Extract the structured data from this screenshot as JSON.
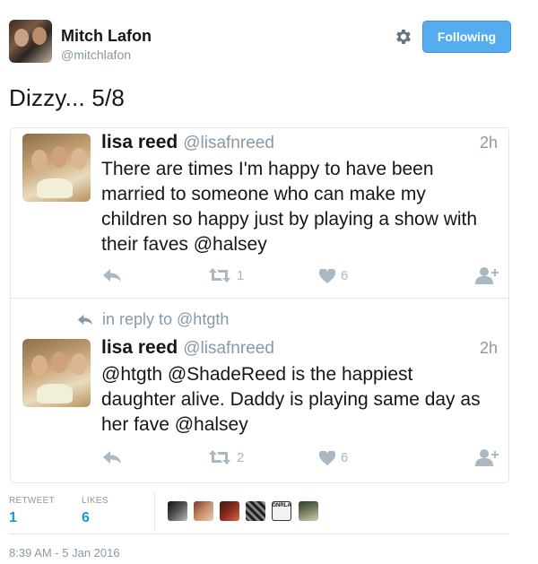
{
  "header": {
    "author_name": "Mitch Lafon",
    "author_handle": "@mitchlafon",
    "follow_label": "Following"
  },
  "tweet": {
    "text": "Dizzy... 5/8"
  },
  "conversation": [
    {
      "name": "lisa reed",
      "handle": "@lisafnreed",
      "time": "2h",
      "text": "There are times I'm happy to have been married to someone who can make my children so happy just by playing a show with their faves @halsey",
      "retweets": "1",
      "likes": "6"
    },
    {
      "reply_context": "in reply to @htgth",
      "name": "lisa reed",
      "handle": "@lisafnreed",
      "time": "2h",
      "text": "@htgth @ShadeReed is the happiest daughter alive. Daddy is playing same day as her fave @halsey",
      "retweets": "2",
      "likes": "6"
    }
  ],
  "stats": {
    "retweet_label": "RETWEET",
    "retweet_count": "1",
    "likes_label": "LIKES",
    "likes_count": "6",
    "liker_badge_text": "GNRLA"
  },
  "timestamp": "8:39 AM - 5 Jan 2016",
  "colors": {
    "accent": "#55acee",
    "link": "#1b95e0",
    "muted": "#8899a6",
    "icon": "#aab8c2",
    "border": "#e1e8ed"
  }
}
